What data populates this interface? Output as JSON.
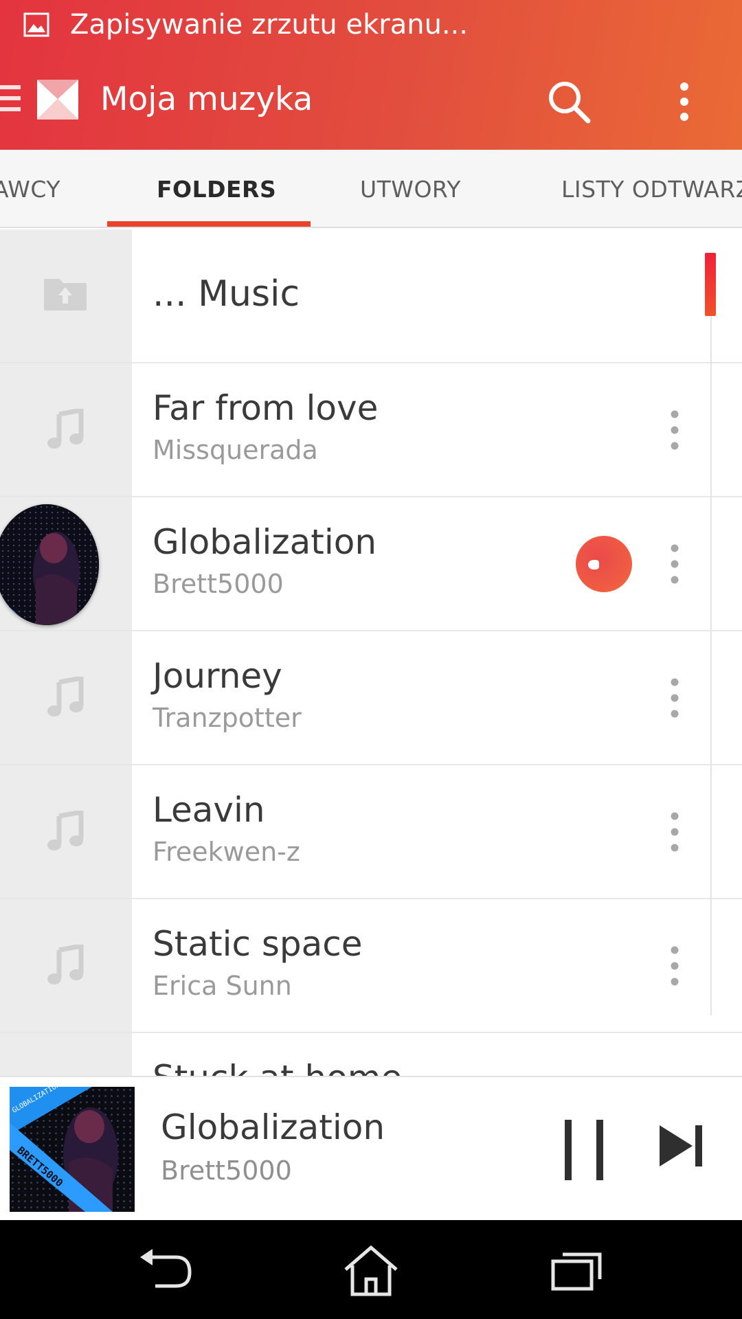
{
  "status_bar": {
    "notification_icon": "image-icon",
    "text": "Zapisywanie zrzutu ekranu..."
  },
  "toolbar": {
    "title": "Moja muzyka",
    "menu_icon": "hamburger-icon",
    "logo_icon": "app-logo-icon",
    "search_icon": "search-icon",
    "more_icon": "more-vert-icon"
  },
  "tabs": [
    {
      "label": "AWCY",
      "active": false
    },
    {
      "label": "FOLDERS",
      "active": true
    },
    {
      "label": "UTWORY",
      "active": false
    },
    {
      "label": "LISTY ODTWARZ",
      "active": false
    }
  ],
  "list": {
    "folder_up": {
      "label": "... Music",
      "icon": "folder-up-icon"
    },
    "items": [
      {
        "title": "Far from love",
        "subtitle": "Missquerada",
        "playing": false
      },
      {
        "title": "Globalization",
        "subtitle": "Brett5000",
        "playing": true
      },
      {
        "title": "Journey",
        "subtitle": "Tranzpotter",
        "playing": false
      },
      {
        "title": "Leavin",
        "subtitle": "Freekwen-z",
        "playing": false
      },
      {
        "title": "Static space",
        "subtitle": "Erica Sunn",
        "playing": false
      },
      {
        "title": "Stuck at home",
        "subtitle": "",
        "playing": false
      }
    ]
  },
  "album_art": {
    "top_text": "GLOBALIZATION",
    "band_text": "BRETT5000"
  },
  "now_playing": {
    "title": "Globalization",
    "artist": "Brett5000",
    "pause_icon": "pause-icon",
    "next_icon": "skip-next-icon"
  },
  "nav_bar": {
    "back_icon": "back-icon",
    "home_icon": "home-icon",
    "recents_icon": "recents-icon"
  },
  "colors": {
    "accent": "#e8432b",
    "header_start": "#e3343f",
    "header_end": "#ea6a36"
  }
}
